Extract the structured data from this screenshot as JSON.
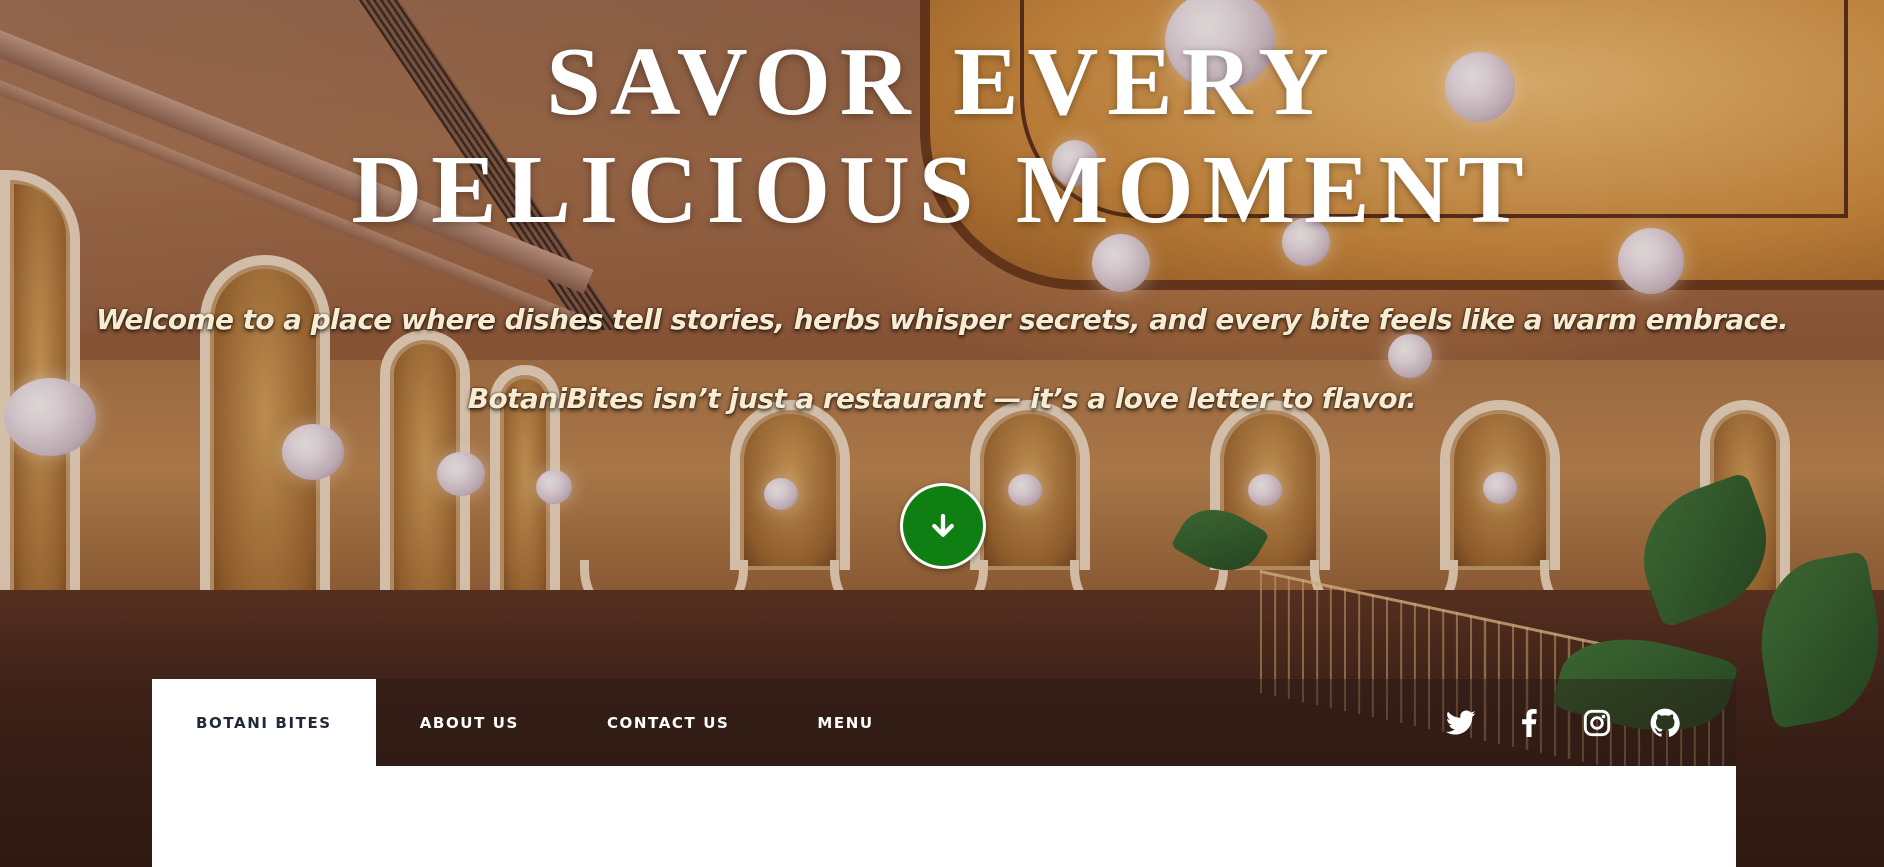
{
  "hero": {
    "title_line1": "SAVOR EVERY",
    "title_line2": "DELICIOUS MOMENT",
    "tagline": "Welcome to a place where dishes tell stories, herbs whisper secrets, and every bite feels like a warm embrace.",
    "subtagline": "BotaniBites isn’t just a restaurant — it’s a love letter to flavor.",
    "scroll_icon": "arrow-down-icon",
    "scroll_button_color": "#0f7f13"
  },
  "navbar": {
    "items": [
      {
        "label": "BOTANI BITES",
        "active": true
      },
      {
        "label": "ABOUT US",
        "active": false
      },
      {
        "label": "CONTACT US",
        "active": false
      },
      {
        "label": "MENU",
        "active": false
      }
    ],
    "social": [
      "twitter-icon",
      "facebook-icon",
      "instagram-icon",
      "github-icon"
    ]
  },
  "colors": {
    "accent_green": "#0f7f13",
    "text_cream": "#f7ecd2",
    "nav_active_text": "#1f2a36"
  }
}
